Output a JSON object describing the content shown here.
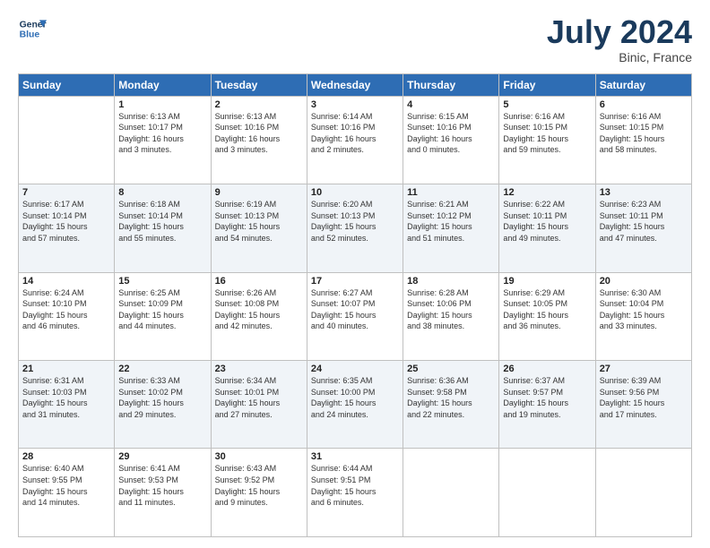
{
  "header": {
    "logo_line1": "General",
    "logo_line2": "Blue",
    "month_title": "July 2024",
    "location": "Binic, France"
  },
  "weekdays": [
    "Sunday",
    "Monday",
    "Tuesday",
    "Wednesday",
    "Thursday",
    "Friday",
    "Saturday"
  ],
  "weeks": [
    [
      {
        "day": "",
        "info": ""
      },
      {
        "day": "1",
        "info": "Sunrise: 6:13 AM\nSunset: 10:17 PM\nDaylight: 16 hours\nand 3 minutes."
      },
      {
        "day": "2",
        "info": "Sunrise: 6:13 AM\nSunset: 10:16 PM\nDaylight: 16 hours\nand 3 minutes."
      },
      {
        "day": "3",
        "info": "Sunrise: 6:14 AM\nSunset: 10:16 PM\nDaylight: 16 hours\nand 2 minutes."
      },
      {
        "day": "4",
        "info": "Sunrise: 6:15 AM\nSunset: 10:16 PM\nDaylight: 16 hours\nand 0 minutes."
      },
      {
        "day": "5",
        "info": "Sunrise: 6:16 AM\nSunset: 10:15 PM\nDaylight: 15 hours\nand 59 minutes."
      },
      {
        "day": "6",
        "info": "Sunrise: 6:16 AM\nSunset: 10:15 PM\nDaylight: 15 hours\nand 58 minutes."
      }
    ],
    [
      {
        "day": "7",
        "info": "Sunrise: 6:17 AM\nSunset: 10:14 PM\nDaylight: 15 hours\nand 57 minutes."
      },
      {
        "day": "8",
        "info": "Sunrise: 6:18 AM\nSunset: 10:14 PM\nDaylight: 15 hours\nand 55 minutes."
      },
      {
        "day": "9",
        "info": "Sunrise: 6:19 AM\nSunset: 10:13 PM\nDaylight: 15 hours\nand 54 minutes."
      },
      {
        "day": "10",
        "info": "Sunrise: 6:20 AM\nSunset: 10:13 PM\nDaylight: 15 hours\nand 52 minutes."
      },
      {
        "day": "11",
        "info": "Sunrise: 6:21 AM\nSunset: 10:12 PM\nDaylight: 15 hours\nand 51 minutes."
      },
      {
        "day": "12",
        "info": "Sunrise: 6:22 AM\nSunset: 10:11 PM\nDaylight: 15 hours\nand 49 minutes."
      },
      {
        "day": "13",
        "info": "Sunrise: 6:23 AM\nSunset: 10:11 PM\nDaylight: 15 hours\nand 47 minutes."
      }
    ],
    [
      {
        "day": "14",
        "info": "Sunrise: 6:24 AM\nSunset: 10:10 PM\nDaylight: 15 hours\nand 46 minutes."
      },
      {
        "day": "15",
        "info": "Sunrise: 6:25 AM\nSunset: 10:09 PM\nDaylight: 15 hours\nand 44 minutes."
      },
      {
        "day": "16",
        "info": "Sunrise: 6:26 AM\nSunset: 10:08 PM\nDaylight: 15 hours\nand 42 minutes."
      },
      {
        "day": "17",
        "info": "Sunrise: 6:27 AM\nSunset: 10:07 PM\nDaylight: 15 hours\nand 40 minutes."
      },
      {
        "day": "18",
        "info": "Sunrise: 6:28 AM\nSunset: 10:06 PM\nDaylight: 15 hours\nand 38 minutes."
      },
      {
        "day": "19",
        "info": "Sunrise: 6:29 AM\nSunset: 10:05 PM\nDaylight: 15 hours\nand 36 minutes."
      },
      {
        "day": "20",
        "info": "Sunrise: 6:30 AM\nSunset: 10:04 PM\nDaylight: 15 hours\nand 33 minutes."
      }
    ],
    [
      {
        "day": "21",
        "info": "Sunrise: 6:31 AM\nSunset: 10:03 PM\nDaylight: 15 hours\nand 31 minutes."
      },
      {
        "day": "22",
        "info": "Sunrise: 6:33 AM\nSunset: 10:02 PM\nDaylight: 15 hours\nand 29 minutes."
      },
      {
        "day": "23",
        "info": "Sunrise: 6:34 AM\nSunset: 10:01 PM\nDaylight: 15 hours\nand 27 minutes."
      },
      {
        "day": "24",
        "info": "Sunrise: 6:35 AM\nSunset: 10:00 PM\nDaylight: 15 hours\nand 24 minutes."
      },
      {
        "day": "25",
        "info": "Sunrise: 6:36 AM\nSunset: 9:58 PM\nDaylight: 15 hours\nand 22 minutes."
      },
      {
        "day": "26",
        "info": "Sunrise: 6:37 AM\nSunset: 9:57 PM\nDaylight: 15 hours\nand 19 minutes."
      },
      {
        "day": "27",
        "info": "Sunrise: 6:39 AM\nSunset: 9:56 PM\nDaylight: 15 hours\nand 17 minutes."
      }
    ],
    [
      {
        "day": "28",
        "info": "Sunrise: 6:40 AM\nSunset: 9:55 PM\nDaylight: 15 hours\nand 14 minutes."
      },
      {
        "day": "29",
        "info": "Sunrise: 6:41 AM\nSunset: 9:53 PM\nDaylight: 15 hours\nand 11 minutes."
      },
      {
        "day": "30",
        "info": "Sunrise: 6:43 AM\nSunset: 9:52 PM\nDaylight: 15 hours\nand 9 minutes."
      },
      {
        "day": "31",
        "info": "Sunrise: 6:44 AM\nSunset: 9:51 PM\nDaylight: 15 hours\nand 6 minutes."
      },
      {
        "day": "",
        "info": ""
      },
      {
        "day": "",
        "info": ""
      },
      {
        "day": "",
        "info": ""
      }
    ]
  ]
}
